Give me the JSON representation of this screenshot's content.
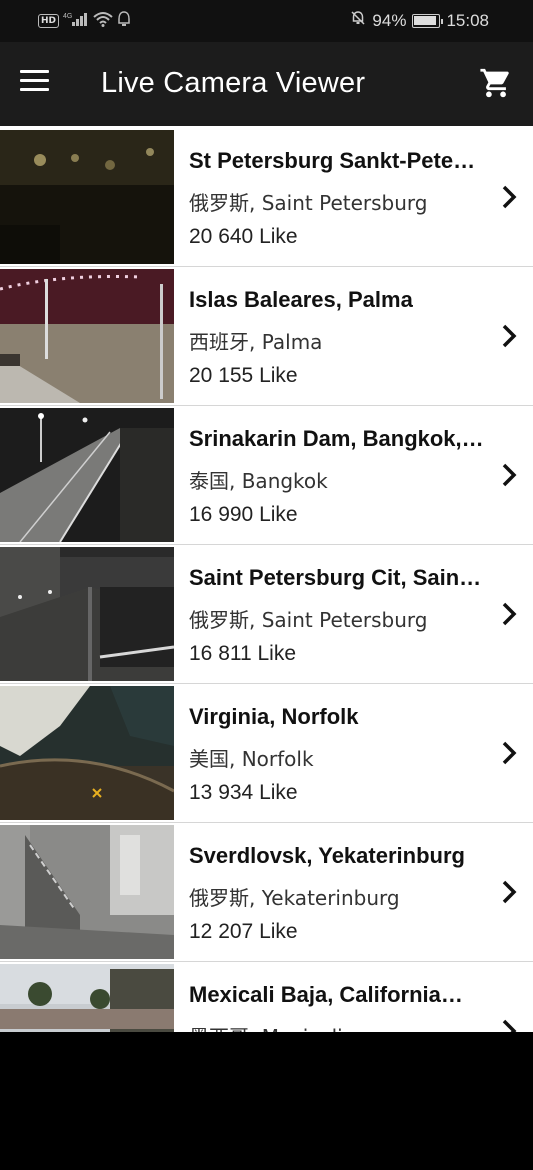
{
  "status": {
    "left_icons": [
      "hd-icon",
      "4g-signal-icon",
      "wifi-icon",
      "notification-icon"
    ],
    "hd": "HD",
    "network": "4G",
    "battery_percent": "94%",
    "battery_level": 0.94,
    "time": "15:08"
  },
  "app_bar": {
    "title": "Live Camera Viewer",
    "menu_icon": "hamburger-menu-icon",
    "cart_icon": "shopping-cart-icon"
  },
  "cameras": [
    {
      "title": "St Petersburg Sankt-Pete…",
      "location": "俄罗斯, Saint Petersburg",
      "likes": "20 640 Like"
    },
    {
      "title": "Islas Baleares, Palma",
      "location": "西班牙, Palma",
      "likes": "20 155 Like"
    },
    {
      "title": "Srinakarin Dam, Bangkok,…",
      "location": "泰国, Bangkok",
      "likes": "16 990 Like"
    },
    {
      "title": "Saint Petersburg Cit, Sain…",
      "location": "俄罗斯, Saint Petersburg",
      "likes": "16 811 Like"
    },
    {
      "title": "Virginia, Norfolk",
      "location": "美国, Norfolk",
      "likes": "13 934 Like"
    },
    {
      "title": "Sverdlovsk, Yekaterinburg",
      "location": "俄罗斯, Yekaterinburg",
      "likes": "12 207 Like"
    },
    {
      "title": "Mexicali Baja, California…",
      "location": "墨西哥, Mexicali",
      "likes": ""
    }
  ],
  "colors": {
    "status_bar": "#111111",
    "app_bar": "#1c1c1c",
    "divider": "#d6d6d6",
    "text_primary": "#111111"
  }
}
